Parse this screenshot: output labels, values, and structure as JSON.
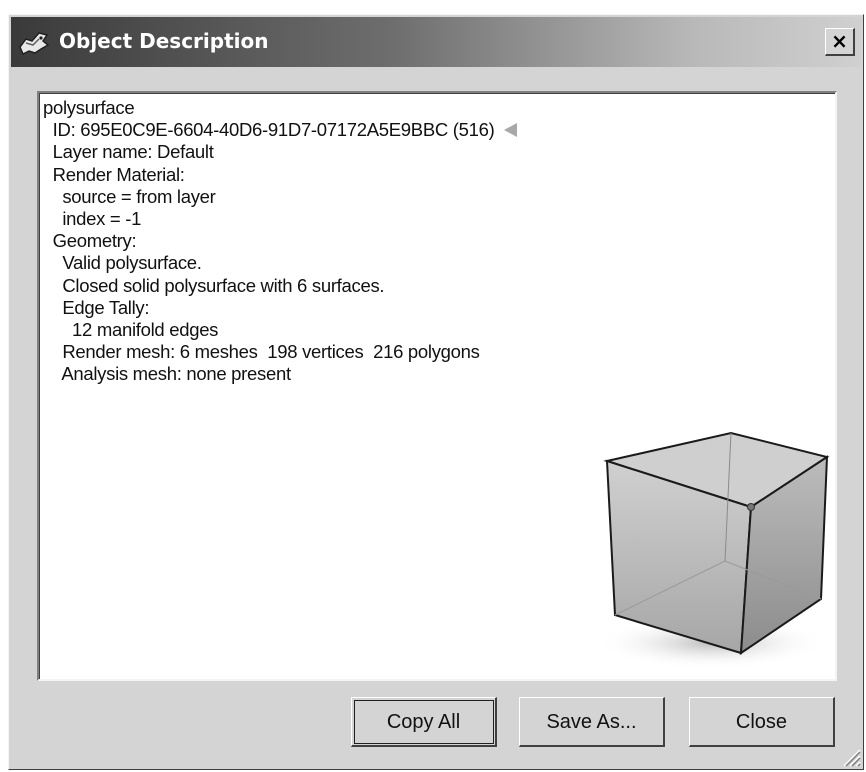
{
  "window": {
    "title": "Object Description",
    "close_glyph": "×",
    "icons": {
      "title": "rhino-app-icon",
      "close": "close-icon",
      "marker": "left-arrow-icon",
      "preview": "cube-preview-icon",
      "grip": "resize-grip-icon"
    }
  },
  "description": {
    "lines": [
      "polysurface",
      "  ID: 695E0C9E-6604-40D6-91D7-07172A5E9BBC (516)",
      "  Layer name: Default",
      "  Render Material:",
      "    source = from layer",
      "    index = -1",
      "  Geometry:",
      "    Valid polysurface.",
      "    Closed solid polysurface with 6 surfaces.",
      "    Edge Tally:",
      "      12 manifold edges",
      "    Render mesh: 6 meshes  198 vertices  216 polygons",
      "    Analysis mesh: none present"
    ]
  },
  "buttons": {
    "copy_all": "Copy All",
    "save_as": "Save As...",
    "close": "Close"
  },
  "colors": {
    "dialog_face": "#d4d4d4",
    "title_gradient_start": "#3a3a3a",
    "pane_bg": "#ffffff",
    "marker": "#a8a8a8"
  }
}
